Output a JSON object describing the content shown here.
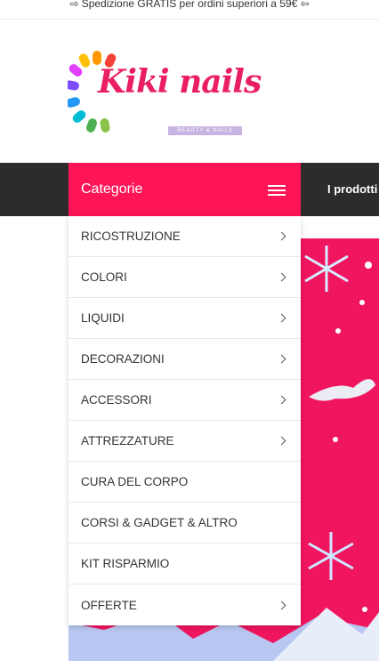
{
  "topbar": {
    "text": "⇨ Spedizione GRATIS per ordini superiori a 59€ ⇦"
  },
  "logo": {
    "name": "Kiki nails",
    "tagline": "BEAUTY & NAILS"
  },
  "nav": {
    "categories_label": "Categorie",
    "link_products": "I prodotti"
  },
  "menu": {
    "items": [
      {
        "label": "RICOSTRUZIONE",
        "has_submenu": true
      },
      {
        "label": "COLORI",
        "has_submenu": true
      },
      {
        "label": "LIQUIDI",
        "has_submenu": true
      },
      {
        "label": "DECORAZIONI",
        "has_submenu": true
      },
      {
        "label": "ACCESSORI",
        "has_submenu": true
      },
      {
        "label": "ATTREZZATURE",
        "has_submenu": true
      },
      {
        "label": "CURA DEL CORPO",
        "has_submenu": false
      },
      {
        "label": "CORSI & GADGET & ALTRO",
        "has_submenu": false
      },
      {
        "label": "KIT RISPARMIO",
        "has_submenu": false
      },
      {
        "label": "OFFERTE",
        "has_submenu": true
      }
    ]
  },
  "colors": {
    "accent": "#ff1556",
    "nav_bg": "#2c2c2c",
    "banner_bg": "#f0155f"
  }
}
